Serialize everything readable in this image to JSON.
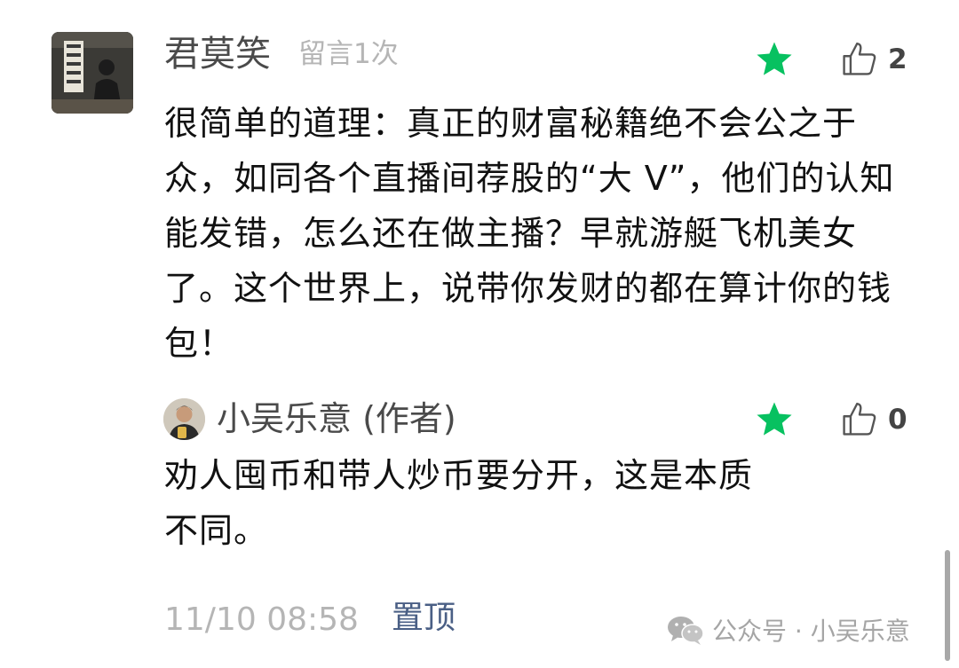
{
  "comment": {
    "username": "君莫笑",
    "badge": "留言1次",
    "like_count": "2",
    "text": "很简单的道理：真正的财富秘籍绝不会公之于众，如同各个直播间荐股的“大 V”，他们的认知能发错，怎么还在做主播？早就游艇飞机美女了。这个世界上，说带你发财的都在算计你的钱包！",
    "star_icon": "star-icon",
    "like_icon": "thumbs-up-icon"
  },
  "reply": {
    "author": "小吴乐意 (作者)",
    "like_count": "0",
    "text": "劝人囤币和带人炒币要分开，这是本质不同。",
    "star_icon": "star-icon",
    "like_icon": "thumbs-up-icon"
  },
  "footer": {
    "timestamp": "11/10 08:58",
    "pin_label": "置顶"
  },
  "watermark": {
    "text": "公众号 · 小吴乐意",
    "icon": "wechat-icon"
  },
  "colors": {
    "star_green": "#07c160",
    "pin_blue": "#4a5f85",
    "muted_gray": "#b5b5b5"
  }
}
